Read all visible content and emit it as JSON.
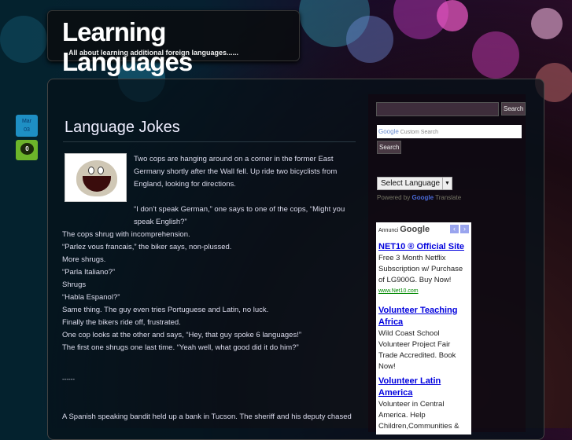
{
  "header": {
    "title": "Learning Languages",
    "tagline": "All about learning additional foreign languages......"
  },
  "post": {
    "date_month": "Mar",
    "date_day": "03",
    "comment_count": "0",
    "title": "Language Jokes",
    "paragraphs": [
      "Two cops are hanging around on a corner in the former East Germany shortly after the Wall fell. Up ride two bicyclists from England, looking for directions.",
      "“I don’t speak German,” one says to one of the cops, “Might you speak English?”"
    ],
    "lines": [
      "The cops shrug with incomprehension.",
      "“Parlez vous francais,” the biker says, non-plussed.",
      "More shrugs.",
      "“Parla Italiano?”",
      "Shrugs",
      "“Habla Espanol?”",
      "Same thing. The guy even tries Portuguese and Latin, no luck.",
      "Finally the bikers ride off, frustrated.",
      "One cop looks at the other and says, “Hey, that guy spoke 6 languages!”",
      "The first one shrugs one last time. “Yeah well, what good did it do him?”"
    ],
    "separator": "------",
    "next": "A Spanish speaking bandit held up a bank in Tucson. The sheriff and his deputy chased"
  },
  "sidebar": {
    "search_button": "Search",
    "google_logo": "Google",
    "custom_search_placeholder": "Custom Search",
    "google_search_button": "Search",
    "select_language": "Select Language",
    "powered_by": "Powered by",
    "translate": "Translate",
    "ads": {
      "label": "Annunci",
      "logo": "Google",
      "items": [
        {
          "title": "NET10 ® Official Site",
          "text": "Free 3 Month Netflix Subscription w/ Purchase of LG900G. Buy Now!",
          "url": "www.Net10.com"
        },
        {
          "title": "Volunteer Teaching Africa",
          "text": "Wild Coast School Volunteer Project Fair Trade Accredited. Book Now!"
        },
        {
          "title": "Volunteer Latin America",
          "text": "Volunteer in Central America. Help Children,Communities &"
        }
      ]
    }
  }
}
